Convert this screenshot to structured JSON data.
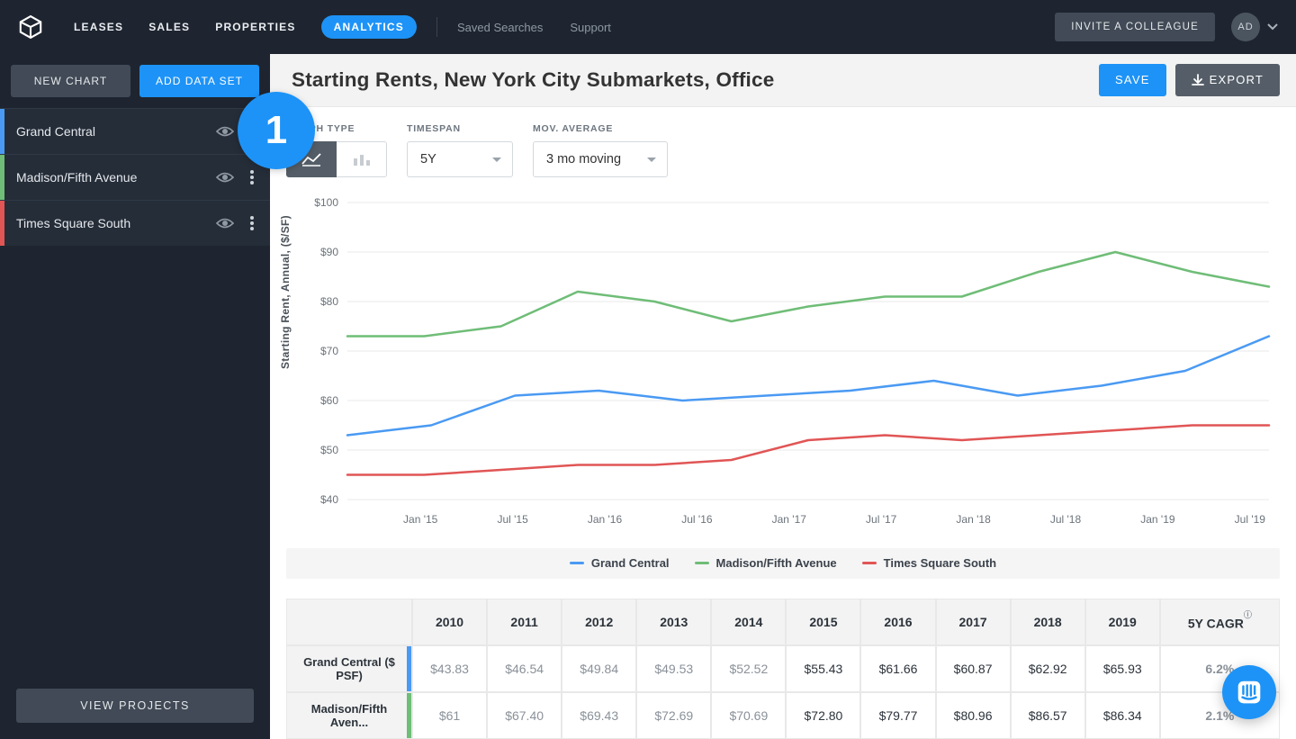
{
  "nav": {
    "items": [
      "LEASES",
      "SALES",
      "PROPERTIES",
      "ANALYTICS"
    ],
    "secondary": [
      "Saved Searches",
      "Support"
    ],
    "invite": "INVITE A COLLEAGUE",
    "avatar_initials": "AD"
  },
  "sidebar": {
    "new_chart": "NEW CHART",
    "add_data_set": "ADD DATA SET",
    "datasets": [
      {
        "label": "Grand Central",
        "color": "#4a9af3"
      },
      {
        "label": "Madison/Fifth Avenue",
        "color": "#6fbd77"
      },
      {
        "label": "Times Square South",
        "color": "#e15555"
      }
    ],
    "view_projects": "VIEW PROJECTS"
  },
  "header": {
    "title": "Starting Rents, New York City Submarkets, Office",
    "save": "SAVE",
    "export": "EXPORT"
  },
  "controls": {
    "graph_type_label": "GRAPH TYPE",
    "timespan_label": "TIMESPAN",
    "timespan_value": "5Y",
    "mov_avg_label": "MOV. AVERAGE",
    "mov_avg_value": "3 mo moving"
  },
  "marker_text": "1",
  "chart_data": {
    "type": "line",
    "title": "Starting Rents, New York City Submarkets, Office",
    "ylabel": "Starting Rent, Annual, ($/SF)",
    "xlabel": "",
    "ylim": [
      40,
      100
    ],
    "x": [
      "Jan '15",
      "Jul '15",
      "Jan '16",
      "Jul '16",
      "Jan '17",
      "Jul '17",
      "Jan '18",
      "Jul '18",
      "Jan '19",
      "Jul '19"
    ],
    "y_ticks": [
      "$40",
      "$50",
      "$60",
      "$70",
      "$80",
      "$90",
      "$100"
    ],
    "series": [
      {
        "name": "Grand Central",
        "color": "#4a9af3",
        "values": [
          53,
          55,
          61,
          62,
          60,
          61,
          62,
          64,
          61,
          63,
          66,
          73
        ]
      },
      {
        "name": "Madison/Fifth Avenue",
        "color": "#6fbd77",
        "values": [
          73,
          73,
          75,
          82,
          80,
          76,
          79,
          81,
          81,
          86,
          90,
          86,
          83
        ]
      },
      {
        "name": "Times Square South",
        "color": "#e15555",
        "values": [
          45,
          45,
          46,
          47,
          47,
          48,
          52,
          53,
          52,
          53,
          54,
          55,
          55
        ]
      }
    ]
  },
  "legend": [
    {
      "label": "Grand Central",
      "color": "#4a9af3"
    },
    {
      "label": "Madison/Fifth Avenue",
      "color": "#6fbd77"
    },
    {
      "label": "Times Square South",
      "color": "#e15555"
    }
  ],
  "table": {
    "years": [
      "2010",
      "2011",
      "2012",
      "2013",
      "2014",
      "2015",
      "2016",
      "2017",
      "2018",
      "2019"
    ],
    "cagr_label": "5Y CAGR",
    "rows": [
      {
        "name": "Grand Central ($ PSF)",
        "color": "#4a9af3",
        "cells": [
          "$43.83",
          "$46.54",
          "$49.84",
          "$49.53",
          "$52.52",
          "$55.43",
          "$61.66",
          "$60.87",
          "$62.92",
          "$65.93"
        ],
        "emph_from": 5,
        "cagr": "6.2%"
      },
      {
        "name": "Madison/Fifth Aven... ",
        "color": "#6fbd77",
        "cells": [
          "$61",
          "$67.40",
          "$69.43",
          "$72.69",
          "$70.69",
          "$72.80",
          "$79.77",
          "$80.96",
          "$86.57",
          "$86.34"
        ],
        "emph_from": 5,
        "cagr": "2.1%"
      }
    ]
  }
}
